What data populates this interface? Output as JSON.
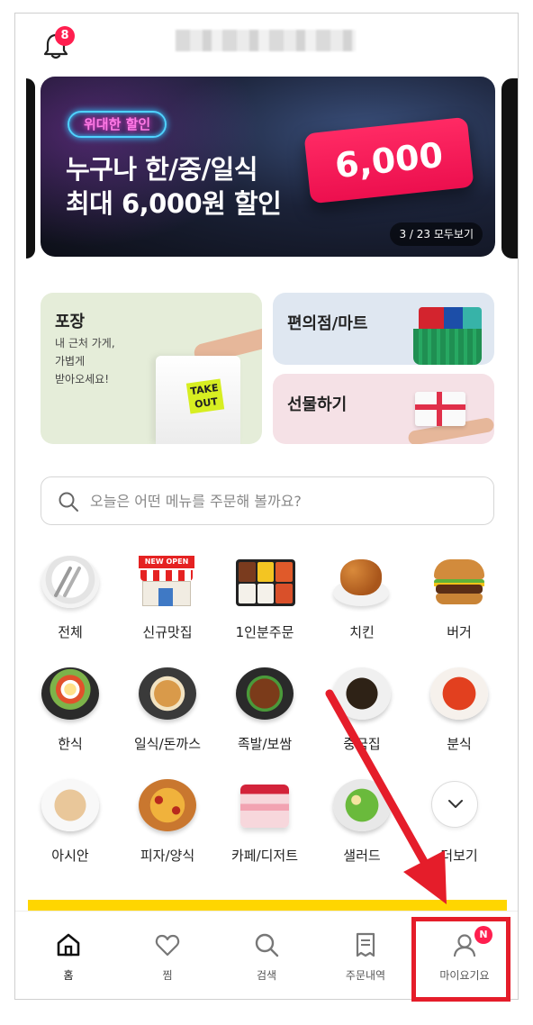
{
  "header": {
    "notification_count": "8",
    "title": ""
  },
  "banner": {
    "tag": "위대한 할인",
    "line1": "누구나 한/중/일식",
    "line2": "최대 6,000원 할인",
    "price": "6,000",
    "counter": "3 / 23 모두보기"
  },
  "cards": {
    "takeout": {
      "title": "포장",
      "desc": "내 근처 가게,\n가볍게\n받아오세요!",
      "bag_label": "TAKE OUT"
    },
    "convenience": {
      "title": "편의점/마트"
    },
    "gift": {
      "title": "선물하기"
    }
  },
  "search": {
    "placeholder": "오늘은 어떤 메뉴를 주문해 볼까요?",
    "value": ""
  },
  "categories": [
    {
      "label": "전체",
      "icon": "plate-icon"
    },
    {
      "label": "신규맛집",
      "icon": "new-open-shop-icon",
      "sign": "NEW OPEN"
    },
    {
      "label": "1인분주문",
      "icon": "lunchbox-icon"
    },
    {
      "label": "치킨",
      "icon": "chicken-icon"
    },
    {
      "label": "버거",
      "icon": "burger-icon"
    },
    {
      "label": "한식",
      "icon": "bibimbap-icon"
    },
    {
      "label": "일식/돈까스",
      "icon": "tonkatsu-icon"
    },
    {
      "label": "족발/보쌈",
      "icon": "jokbal-icon"
    },
    {
      "label": "중국집",
      "icon": "jajangmyeon-icon"
    },
    {
      "label": "분식",
      "icon": "tteokbokki-icon"
    },
    {
      "label": "아시안",
      "icon": "pho-icon"
    },
    {
      "label": "피자/양식",
      "icon": "pizza-icon"
    },
    {
      "label": "카페/디저트",
      "icon": "cake-icon"
    },
    {
      "label": "샐러드",
      "icon": "salad-icon"
    },
    {
      "label": "더보기",
      "icon": "chevron-down-icon"
    }
  ],
  "tabbar": [
    {
      "label": "홈",
      "icon": "home-icon",
      "active": true
    },
    {
      "label": "찜",
      "icon": "heart-icon"
    },
    {
      "label": "검색",
      "icon": "search-icon"
    },
    {
      "label": "주문내역",
      "icon": "receipt-icon"
    },
    {
      "label": "마이요기요",
      "icon": "profile-icon",
      "badge": "N"
    }
  ],
  "colors": {
    "brand_yellow": "#ffd600",
    "badge_red": "#ff1f4f",
    "annotation_red": "#e51d2a",
    "price_pink": "#ff2a64"
  }
}
